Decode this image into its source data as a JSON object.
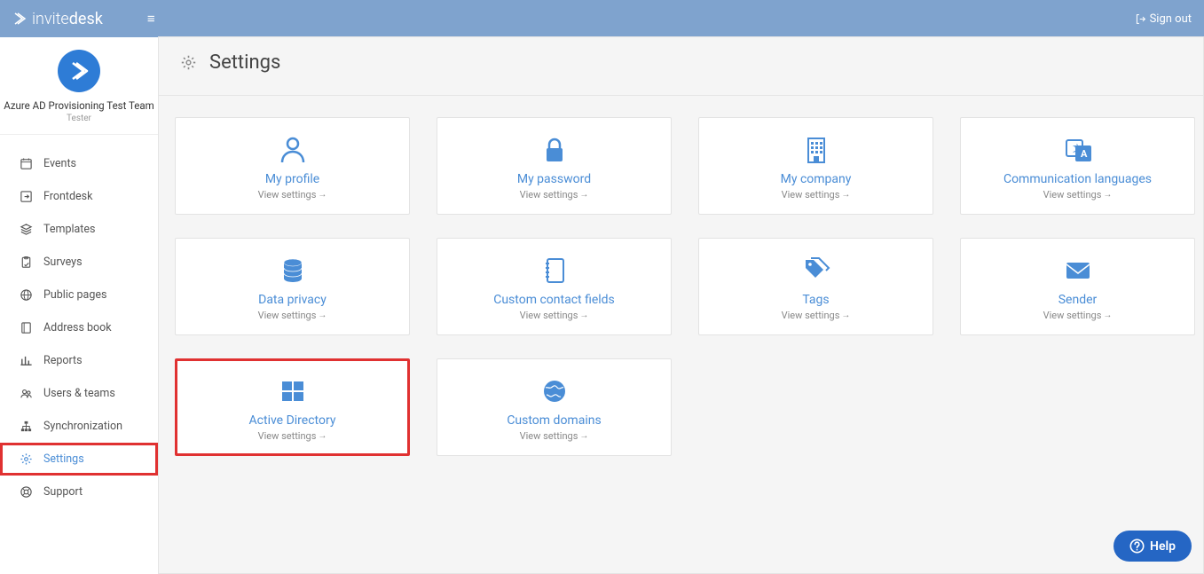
{
  "brand": {
    "name_light": "invite",
    "name_bold": "desk"
  },
  "topbar": {
    "signout": "Sign out"
  },
  "sidebar": {
    "team": "Azure AD Provisioning Test Team",
    "role": "Tester",
    "items": [
      {
        "label": "Events",
        "icon": "calendar"
      },
      {
        "label": "Frontdesk",
        "icon": "enter"
      },
      {
        "label": "Templates",
        "icon": "layers"
      },
      {
        "label": "Surveys",
        "icon": "clipboard"
      },
      {
        "label": "Public pages",
        "icon": "globe"
      },
      {
        "label": "Address book",
        "icon": "book"
      },
      {
        "label": "Reports",
        "icon": "bars"
      },
      {
        "label": "Users & teams",
        "icon": "users"
      },
      {
        "label": "Synchronization",
        "icon": "sitemap"
      },
      {
        "label": "Settings",
        "icon": "gear",
        "active": true,
        "highlight": true
      },
      {
        "label": "Support",
        "icon": "lifebuoy"
      }
    ]
  },
  "page": {
    "title": "Settings",
    "view_label": "View settings"
  },
  "cards": [
    {
      "title": "My profile",
      "icon": "user"
    },
    {
      "title": "My password",
      "icon": "lock"
    },
    {
      "title": "My company",
      "icon": "building"
    },
    {
      "title": "Communication languages",
      "icon": "lang"
    },
    {
      "title": "Data privacy",
      "icon": "database"
    },
    {
      "title": "Custom contact fields",
      "icon": "notebook"
    },
    {
      "title": "Tags",
      "icon": "tags"
    },
    {
      "title": "Sender",
      "icon": "envelope"
    },
    {
      "title": "Active Directory",
      "icon": "windows",
      "highlight": true
    },
    {
      "title": "Custom domains",
      "icon": "world"
    }
  ],
  "help": {
    "label": "Help"
  }
}
